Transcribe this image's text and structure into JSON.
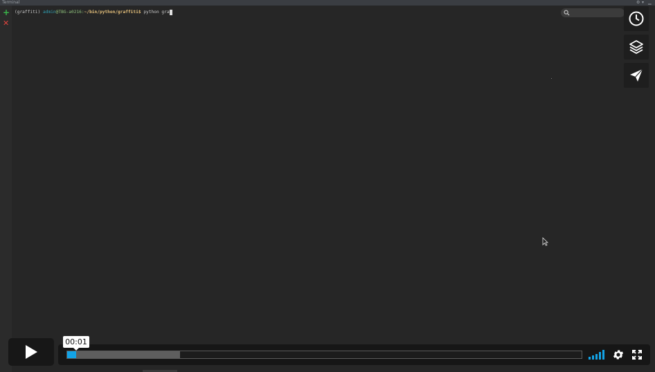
{
  "window": {
    "title": "Terminal"
  },
  "terminal": {
    "prompt_env": "(graffiti)",
    "prompt_user": "admin",
    "prompt_host": "@TBG-a0216:",
    "prompt_path": "~/bin/python/graffiti",
    "prompt_symbol": "$",
    "command": "python gra"
  },
  "side_tools": [
    {
      "icon": "clock-icon"
    },
    {
      "icon": "layers-icon"
    },
    {
      "icon": "send-icon"
    }
  ],
  "player": {
    "time_tooltip": "00:01",
    "progress_fraction": 0.018,
    "buffered_fraction": 0.22,
    "colors": {
      "accent": "#13a3e6",
      "buffered": "#5e5e5e",
      "bar_bg": "#161616"
    }
  }
}
